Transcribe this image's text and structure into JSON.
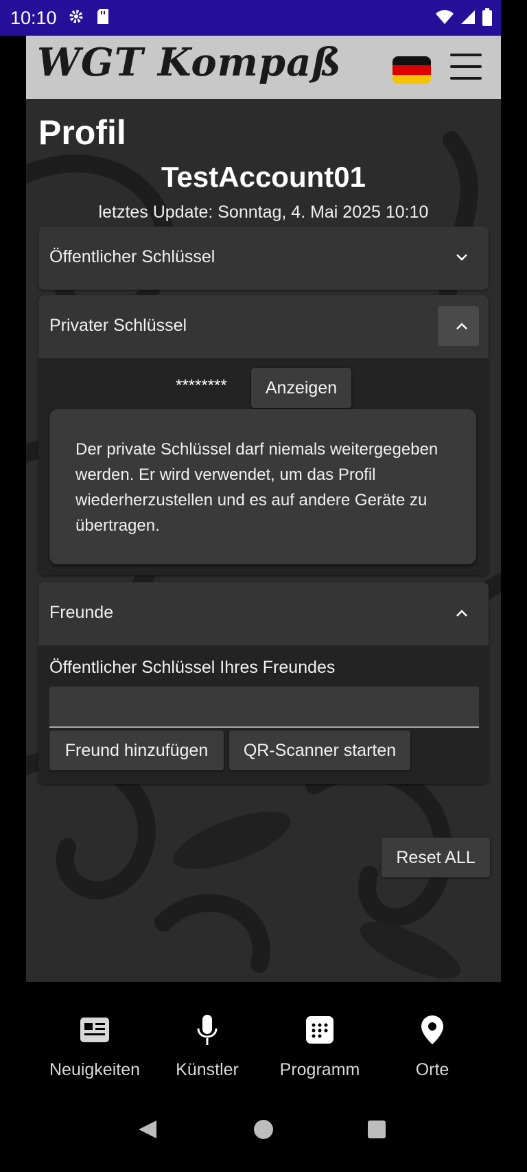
{
  "status_bar": {
    "time": "10:10",
    "left_icons": [
      "gear-icon",
      "sd-card-icon"
    ],
    "right_icons": [
      "wifi-icon",
      "signal-icon",
      "battery-icon"
    ]
  },
  "header": {
    "logo_text": "WGT Kompaß",
    "language_flag": "germany-flag",
    "menu_icon": "hamburger-menu-icon"
  },
  "profile": {
    "title": "Profil",
    "account_name": "TestAccount01",
    "last_update": "letztes Update: Sonntag, 4. Mai 2025 10:10"
  },
  "sections": {
    "public_key": {
      "title": "Öffentlicher Schlüssel",
      "expanded": false
    },
    "private_key": {
      "title": "Privater Schlüssel",
      "expanded": true,
      "masked_value": "********",
      "show_button": "Anzeigen",
      "warning": "Der private Schlüssel darf niemals weitergegeben werden. Er wird verwendet, um das Profil wiederherzustellen und es auf andere Geräte zu übertragen."
    },
    "friends": {
      "title": "Freunde",
      "expanded": true,
      "input_label": "Öffentlicher Schlüssel Ihres Freundes",
      "input_value": "",
      "add_button": "Freund hinzufügen",
      "scan_button": "QR-Scanner starten"
    }
  },
  "reset_button": "Reset ALL",
  "bottom_nav": [
    {
      "label": "Neuigkeiten",
      "icon": "newspaper-icon"
    },
    {
      "label": "Künstler",
      "icon": "microphone-icon"
    },
    {
      "label": "Programm",
      "icon": "calendar-grid-icon"
    },
    {
      "label": "Orte",
      "icon": "location-pin-icon"
    }
  ],
  "system_nav": [
    "back-icon",
    "home-icon",
    "recents-icon"
  ],
  "colors": {
    "status_bar": "#26109a",
    "header": "#c8c8c8",
    "panel": "#353535",
    "panel_body": "#232323"
  }
}
